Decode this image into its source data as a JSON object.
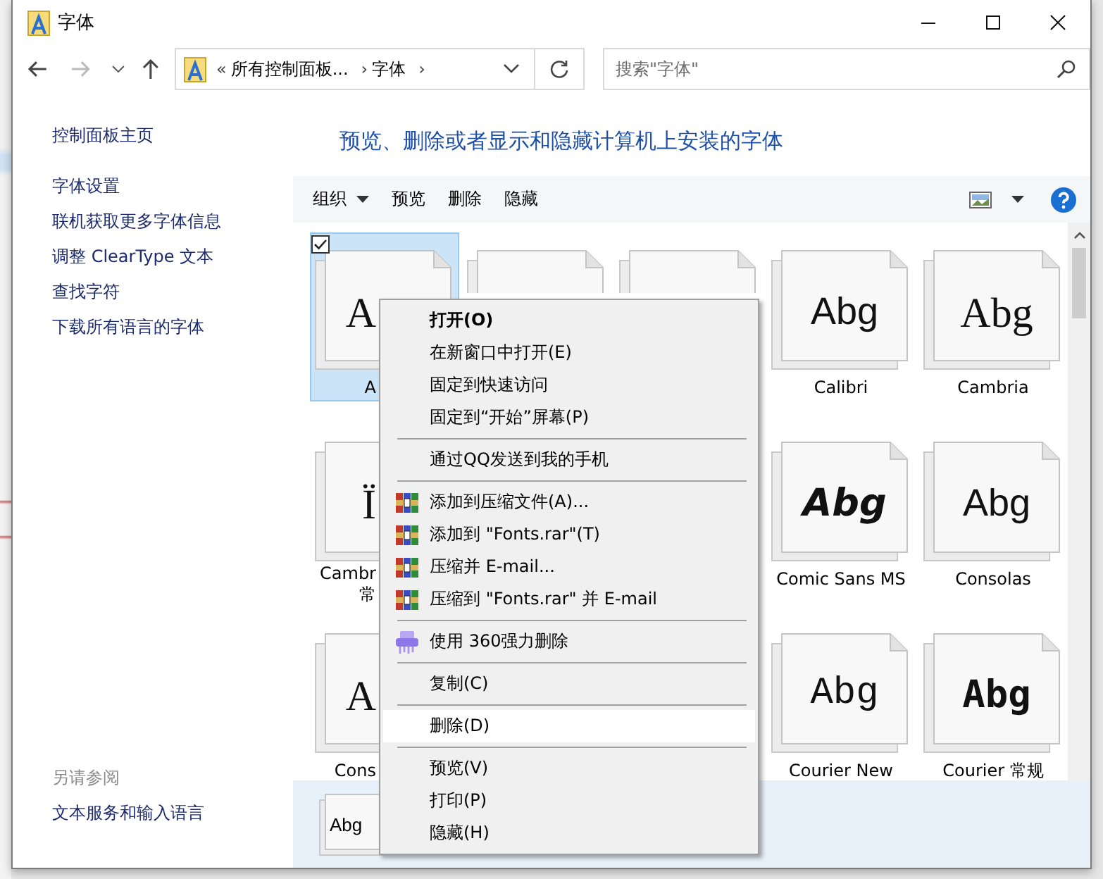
{
  "window": {
    "title": "字体"
  },
  "nav": {
    "breadcrumbs": [
      "«",
      "所有控制面板...",
      "›",
      "字体",
      "›"
    ],
    "search": {
      "placeholder": "搜索\"字体\""
    }
  },
  "sidebar": {
    "items": [
      {
        "label": "控制面板主页"
      },
      {
        "label": "字体设置"
      },
      {
        "label": "联机获取更多字体信息"
      },
      {
        "label": "调整 ClearType 文本"
      },
      {
        "label": "查找字符"
      },
      {
        "label": "下载所有语言的字体"
      }
    ],
    "see_also": {
      "title": "另请参阅",
      "items": [
        {
          "label": "文本服务和输入语言"
        }
      ]
    }
  },
  "heading": "预览、删除或者显示和隐藏计算机上安装的字体",
  "toolbar": {
    "items": [
      {
        "label": "组织",
        "dropdown": true
      },
      {
        "label": "预览",
        "dropdown": false
      },
      {
        "label": "删除",
        "dropdown": false
      },
      {
        "label": "隐藏",
        "dropdown": false
      }
    ]
  },
  "fonts": [
    {
      "preview": "A",
      "label": "A",
      "kind": "serif",
      "selected": true
    },
    {
      "selected": false
    },
    {
      "selected": false
    },
    {
      "preview": "Abg",
      "label": "Calibri",
      "kind": "sans",
      "selected": false
    },
    {
      "preview": "Abg",
      "label": "Cambria",
      "kind": "serif",
      "selected": false
    },
    {
      "preview": "Ï",
      "label": "Cambr",
      "label2": "常",
      "kind": "serif",
      "selected": false
    },
    {
      "preview": "Abg",
      "label": "Comic Sans MS",
      "kind": "script",
      "selected": false
    },
    {
      "preview": "Abg",
      "label": "Consolas",
      "kind": "sans",
      "selected": false
    },
    {
      "preview": "A",
      "label": "Cons",
      "kind": "serif",
      "selected": false
    },
    {
      "preview": "Abg",
      "label": "Courier New",
      "kind": "mono",
      "selected": false
    },
    {
      "preview": "Abg",
      "label": "Courier 常规",
      "kind": "monobold",
      "selected": false
    }
  ],
  "details": {
    "preview": "Abg"
  },
  "context_menu": [
    {
      "kind": "item",
      "label": "打开(O)",
      "default": true,
      "selected": false
    },
    {
      "kind": "item",
      "label": "在新窗口中打开(E)",
      "default": false,
      "selected": false
    },
    {
      "kind": "item",
      "label": "固定到快速访问",
      "default": false,
      "selected": false
    },
    {
      "kind": "item",
      "label": "固定到“开始”屏幕(P)",
      "default": false,
      "selected": false
    },
    {
      "kind": "separator"
    },
    {
      "kind": "item",
      "label": "通过QQ发送到我的手机",
      "default": false,
      "selected": false
    },
    {
      "kind": "separator"
    },
    {
      "kind": "archive",
      "label": "添加到压缩文件(A)...",
      "default": false,
      "selected": false
    },
    {
      "kind": "archive",
      "label": "添加到 \"Fonts.rar\"(T)",
      "default": false,
      "selected": false
    },
    {
      "kind": "archive",
      "label": "压缩并 E-mail...",
      "default": false,
      "selected": false
    },
    {
      "kind": "archive",
      "label": "压缩到 \"Fonts.rar\" 并 E-mail",
      "default": false,
      "selected": false
    },
    {
      "kind": "separator"
    },
    {
      "kind": "shredder",
      "label": "使用 360强力删除",
      "default": false,
      "selected": false
    },
    {
      "kind": "separator"
    },
    {
      "kind": "item",
      "label": "复制(C)",
      "default": false,
      "selected": false
    },
    {
      "kind": "separator"
    },
    {
      "kind": "item",
      "label": "删除(D)",
      "default": false,
      "selected": true
    },
    {
      "kind": "separator"
    },
    {
      "kind": "item",
      "label": "预览(V)",
      "default": false,
      "selected": false
    },
    {
      "kind": "item",
      "label": "打印(P)",
      "default": false,
      "selected": false
    },
    {
      "kind": "item",
      "label": "隐藏(H)",
      "default": false,
      "selected": false
    }
  ]
}
